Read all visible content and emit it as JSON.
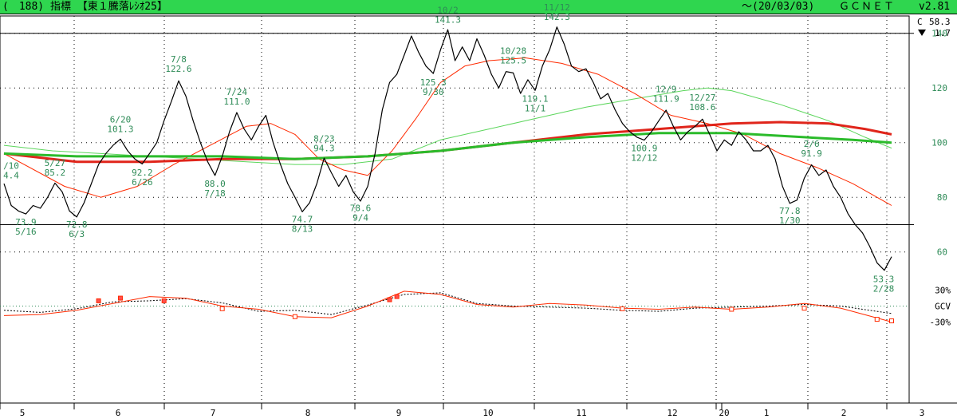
{
  "header": {
    "title": "(　188) 指標 【東１騰落ﾚｼｵ25】",
    "date_range": "～(20/03/03)",
    "brand": "ＧＣＮＥＴ",
    "version": "v2.81",
    "accent_color": "#2fd64f"
  },
  "side_info": {
    "close_label": "C",
    "close_value": "58.3",
    "change_value": "1.7",
    "change_direction": "down"
  },
  "chart_data": {
    "type": "line",
    "y_axis": {
      "ticks": [
        140,
        120,
        100,
        80,
        60
      ],
      "range": [
        50,
        144
      ],
      "reference_lines": [
        140,
        70
      ]
    },
    "months": [
      "5",
      "6",
      "7",
      "8",
      "9",
      "10",
      "11",
      "12",
      "20",
      "1",
      "2",
      "3"
    ],
    "series": [
      {
        "role": "main",
        "color": "#000000",
        "points": [
          [
            0,
            85
          ],
          [
            3,
            77
          ],
          [
            6,
            75
          ],
          [
            9,
            73.9
          ],
          [
            12,
            77
          ],
          [
            15,
            76
          ],
          [
            18,
            80
          ],
          [
            21,
            85.2
          ],
          [
            24,
            82
          ],
          [
            27,
            75
          ],
          [
            30,
            72.8
          ],
          [
            33,
            78
          ],
          [
            36,
            85
          ],
          [
            39,
            92
          ],
          [
            42,
            96
          ],
          [
            45,
            99
          ],
          [
            48,
            101.3
          ],
          [
            51,
            97
          ],
          [
            54,
            94
          ],
          [
            57,
            92.2
          ],
          [
            60,
            96
          ],
          [
            63,
            100
          ],
          [
            66,
            108
          ],
          [
            69,
            115
          ],
          [
            72,
            122.6
          ],
          [
            75,
            117
          ],
          [
            78,
            108
          ],
          [
            81,
            100
          ],
          [
            84,
            93
          ],
          [
            87,
            88.0
          ],
          [
            90,
            95
          ],
          [
            93,
            104
          ],
          [
            96,
            111.0
          ],
          [
            99,
            105
          ],
          [
            102,
            101
          ],
          [
            105,
            106
          ],
          [
            108,
            110
          ],
          [
            111,
            100
          ],
          [
            114,
            92
          ],
          [
            117,
            85
          ],
          [
            120,
            80
          ],
          [
            123,
            74.7
          ],
          [
            126,
            78
          ],
          [
            129,
            85
          ],
          [
            132,
            94.3
          ],
          [
            135,
            89
          ],
          [
            138,
            84
          ],
          [
            141,
            88
          ],
          [
            144,
            82
          ],
          [
            147,
            78.6
          ],
          [
            150,
            84
          ],
          [
            153,
            96
          ],
          [
            156,
            112
          ],
          [
            159,
            122
          ],
          [
            162,
            125
          ],
          [
            165,
            132
          ],
          [
            168,
            139
          ],
          [
            171,
            133
          ],
          [
            174,
            128
          ],
          [
            177,
            125.3
          ],
          [
            180,
            134
          ],
          [
            183,
            141.3
          ],
          [
            186,
            130
          ],
          [
            189,
            135
          ],
          [
            192,
            130
          ],
          [
            195,
            138
          ],
          [
            198,
            132
          ],
          [
            201,
            125
          ],
          [
            204,
            120
          ],
          [
            207,
            126
          ],
          [
            210,
            125.5
          ],
          [
            213,
            118
          ],
          [
            216,
            123
          ],
          [
            219,
            119.1
          ],
          [
            222,
            128
          ],
          [
            225,
            134
          ],
          [
            228,
            142.3
          ],
          [
            231,
            136
          ],
          [
            234,
            128
          ],
          [
            237,
            126
          ],
          [
            240,
            127
          ],
          [
            243,
            122
          ],
          [
            246,
            116
          ],
          [
            249,
            118
          ],
          [
            252,
            112
          ],
          [
            255,
            107
          ],
          [
            258,
            104
          ],
          [
            261,
            102
          ],
          [
            264,
            100.9
          ],
          [
            267,
            104
          ],
          [
            270,
            108
          ],
          [
            273,
            111.9
          ],
          [
            276,
            106
          ],
          [
            279,
            101
          ],
          [
            282,
            104
          ],
          [
            285,
            106
          ],
          [
            288,
            108.6
          ],
          [
            291,
            103
          ],
          [
            294,
            97
          ],
          [
            297,
            101
          ],
          [
            300,
            99
          ],
          [
            303,
            104
          ],
          [
            306,
            101
          ],
          [
            309,
            97
          ],
          [
            312,
            97
          ],
          [
            315,
            99
          ],
          [
            318,
            94
          ],
          [
            321,
            84
          ],
          [
            324,
            77.8
          ],
          [
            327,
            79
          ],
          [
            330,
            87
          ],
          [
            333,
            91.9
          ],
          [
            336,
            88
          ],
          [
            339,
            90
          ],
          [
            342,
            84
          ],
          [
            345,
            80
          ],
          [
            348,
            74
          ],
          [
            351,
            70
          ],
          [
            354,
            67
          ],
          [
            357,
            62
          ],
          [
            360,
            56
          ],
          [
            363,
            53.3
          ],
          [
            366,
            58.3
          ]
        ]
      },
      {
        "role": "ma-short",
        "color": "#ff2a00",
        "points": [
          [
            0,
            96
          ],
          [
            25,
            84
          ],
          [
            40,
            80
          ],
          [
            55,
            84
          ],
          [
            70,
            92
          ],
          [
            85,
            99
          ],
          [
            100,
            106
          ],
          [
            110,
            107
          ],
          [
            120,
            103
          ],
          [
            130,
            94
          ],
          [
            140,
            90
          ],
          [
            150,
            88
          ],
          [
            160,
            97
          ],
          [
            170,
            109
          ],
          [
            180,
            122
          ],
          [
            190,
            128
          ],
          [
            200,
            130
          ],
          [
            215,
            131
          ],
          [
            230,
            129
          ],
          [
            245,
            125
          ],
          [
            260,
            118
          ],
          [
            275,
            110
          ],
          [
            290,
            107
          ],
          [
            305,
            103
          ],
          [
            320,
            96
          ],
          [
            335,
            91
          ],
          [
            350,
            85
          ],
          [
            366,
            77
          ]
        ]
      },
      {
        "role": "ma-mid",
        "color": "#5cd65c",
        "points": [
          [
            0,
            99
          ],
          [
            20,
            97
          ],
          [
            40,
            96
          ],
          [
            60,
            95
          ],
          [
            80,
            94
          ],
          [
            100,
            93
          ],
          [
            120,
            92
          ],
          [
            140,
            92
          ],
          [
            160,
            94
          ],
          [
            180,
            101
          ],
          [
            200,
            105
          ],
          [
            220,
            109
          ],
          [
            240,
            113
          ],
          [
            260,
            116
          ],
          [
            280,
            119
          ],
          [
            290,
            120
          ],
          [
            300,
            119
          ],
          [
            320,
            114
          ],
          [
            340,
            108
          ],
          [
            355,
            102
          ],
          [
            366,
            98
          ]
        ]
      },
      {
        "role": "ma-long",
        "color": "#e0251b",
        "points": [
          [
            0,
            96
          ],
          [
            30,
            93
          ],
          [
            60,
            93
          ],
          [
            90,
            94
          ],
          [
            120,
            94
          ],
          [
            150,
            95
          ],
          [
            180,
            97
          ],
          [
            210,
            100
          ],
          [
            240,
            103
          ],
          [
            270,
            105
          ],
          [
            300,
            107
          ],
          [
            320,
            107.5
          ],
          [
            340,
            107
          ],
          [
            355,
            105
          ],
          [
            366,
            103
          ]
        ]
      },
      {
        "role": "ma-longer",
        "color": "#2bbb2b",
        "points": [
          [
            0,
            96
          ],
          [
            30,
            95
          ],
          [
            60,
            95
          ],
          [
            90,
            95
          ],
          [
            120,
            94
          ],
          [
            150,
            95
          ],
          [
            180,
            97
          ],
          [
            210,
            100
          ],
          [
            240,
            102
          ],
          [
            270,
            103.5
          ],
          [
            300,
            103.5
          ],
          [
            330,
            102
          ],
          [
            350,
            101
          ],
          [
            366,
            100
          ]
        ]
      }
    ],
    "labels": [
      {
        "x": 0,
        "y": 84,
        "lines": [
          "/10",
          "4.4"
        ]
      },
      {
        "x": 9,
        "y": 74,
        "lines": [
          "73.9",
          "5/16"
        ]
      },
      {
        "x": 21,
        "y": 85,
        "lines": [
          "5/27",
          "85.2"
        ]
      },
      {
        "x": 30,
        "y": 73,
        "lines": [
          "72.8",
          "6/3"
        ]
      },
      {
        "x": 48,
        "y": 101,
        "lines": [
          "6/20",
          "101.3"
        ]
      },
      {
        "x": 57,
        "y": 92,
        "lines": [
          "92.2",
          "6/26"
        ]
      },
      {
        "x": 72,
        "y": 123,
        "lines": [
          "7/8",
          "122.6"
        ]
      },
      {
        "x": 87,
        "y": 88,
        "lines": [
          "88.0",
          "7/18"
        ]
      },
      {
        "x": 96,
        "y": 111,
        "lines": [
          "7/24",
          "111.0"
        ]
      },
      {
        "x": 123,
        "y": 75,
        "lines": [
          "74.7",
          "8/13"
        ]
      },
      {
        "x": 132,
        "y": 94,
        "lines": [
          "8/23",
          "94.3"
        ]
      },
      {
        "x": 147,
        "y": 79,
        "lines": [
          "78.6",
          "9/4"
        ]
      },
      {
        "x": 177,
        "y": 125,
        "lines": [
          "125.3",
          "9/30"
        ]
      },
      {
        "x": 183,
        "y": 141,
        "lines": [
          "10/2",
          "141.3"
        ]
      },
      {
        "x": 210,
        "y": 126,
        "lines": [
          "10/28",
          "125.5"
        ]
      },
      {
        "x": 219,
        "y": 119,
        "lines": [
          "119.1",
          "11/1"
        ]
      },
      {
        "x": 228,
        "y": 142,
        "lines": [
          "11/12",
          "142.3"
        ]
      },
      {
        "x": 264,
        "y": 101,
        "lines": [
          "100.9",
          "12/12"
        ]
      },
      {
        "x": 273,
        "y": 112,
        "lines": [
          "12/9",
          "111.9"
        ]
      },
      {
        "x": 288,
        "y": 109,
        "lines": [
          "12/27",
          "108.6"
        ]
      },
      {
        "x": 324,
        "y": 78,
        "lines": [
          "77.8",
          "1/30"
        ]
      },
      {
        "x": 333,
        "y": 92,
        "lines": [
          "2/6",
          "91.9"
        ]
      },
      {
        "x": 363,
        "y": 53,
        "lines": [
          "53.3",
          "2/28"
        ]
      }
    ],
    "oscillator": {
      "labels": [
        "30%",
        "GCV",
        "-30%"
      ],
      "range": [
        -40,
        40
      ],
      "red": [
        [
          0,
          -18
        ],
        [
          15,
          -16
        ],
        [
          30,
          -8
        ],
        [
          45,
          5
        ],
        [
          60,
          18
        ],
        [
          75,
          15
        ],
        [
          90,
          0
        ],
        [
          105,
          -6
        ],
        [
          120,
          -20
        ],
        [
          135,
          -22
        ],
        [
          150,
          0
        ],
        [
          165,
          28
        ],
        [
          180,
          22
        ],
        [
          195,
          3
        ],
        [
          210,
          -2
        ],
        [
          225,
          5
        ],
        [
          240,
          2
        ],
        [
          255,
          -4
        ],
        [
          270,
          -6
        ],
        [
          285,
          -2
        ],
        [
          300,
          -6
        ],
        [
          315,
          -2
        ],
        [
          330,
          5
        ],
        [
          345,
          -4
        ],
        [
          366,
          -30
        ]
      ],
      "black": [
        [
          0,
          -8
        ],
        [
          15,
          -12
        ],
        [
          30,
          -5
        ],
        [
          45,
          8
        ],
        [
          60,
          10
        ],
        [
          75,
          14
        ],
        [
          90,
          6
        ],
        [
          105,
          -10
        ],
        [
          120,
          -8
        ],
        [
          135,
          -16
        ],
        [
          150,
          2
        ],
        [
          165,
          22
        ],
        [
          180,
          25
        ],
        [
          195,
          5
        ],
        [
          210,
          0
        ],
        [
          225,
          -2
        ],
        [
          240,
          -4
        ],
        [
          255,
          -8
        ],
        [
          270,
          -10
        ],
        [
          285,
          -4
        ],
        [
          300,
          -2
        ],
        [
          315,
          0
        ],
        [
          330,
          3
        ],
        [
          345,
          0
        ],
        [
          366,
          -14
        ]
      ],
      "markers": [
        [
          39,
          10
        ],
        [
          48,
          15
        ],
        [
          66,
          10
        ],
        [
          90,
          -5
        ],
        [
          120,
          -20
        ],
        [
          159,
          12
        ],
        [
          162,
          18
        ],
        [
          255,
          -5
        ],
        [
          300,
          -6
        ],
        [
          330,
          -4
        ],
        [
          360,
          -25
        ],
        [
          366,
          -28
        ]
      ]
    }
  }
}
